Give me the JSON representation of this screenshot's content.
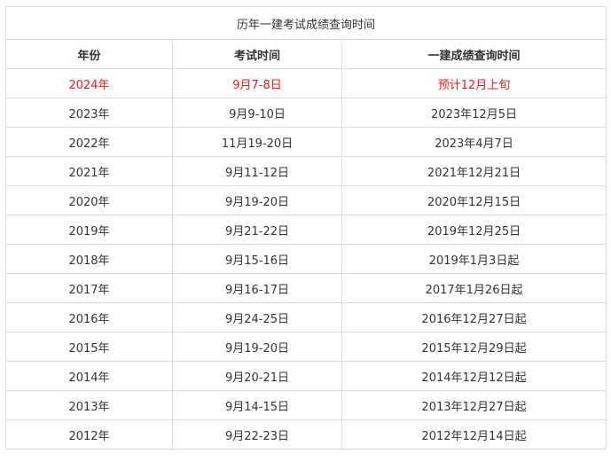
{
  "table": {
    "title": "历年一建考试成绩查询时间",
    "headers": [
      "年份",
      "考试时间",
      "一建成绩查询时间"
    ],
    "highlight_color": "#e02020",
    "rows": [
      {
        "year": "2024年",
        "exam": "9月7-8日",
        "result": "预计12月上旬",
        "highlight": true
      },
      {
        "year": "2023年",
        "exam": "9月9-10日",
        "result": "2023年12月5日"
      },
      {
        "year": "2022年",
        "exam": "11月19-20日",
        "result": "2023年4月7日"
      },
      {
        "year": "2021年",
        "exam": "9月11-12日",
        "result": "2021年12月21日"
      },
      {
        "year": "2020年",
        "exam": "9月19-20日",
        "result": "2020年12月15日"
      },
      {
        "year": "2019年",
        "exam": "9月21-22日",
        "result": "2019年12月25日"
      },
      {
        "year": "2018年",
        "exam": "9月15-16日",
        "result": "2019年1月3日起"
      },
      {
        "year": "2017年",
        "exam": "9月16-17日",
        "result": "2017年1月26日起"
      },
      {
        "year": "2016年",
        "exam": "9月24-25日",
        "result": "2016年12月27日起"
      },
      {
        "year": "2015年",
        "exam": "9月19-20日",
        "result": "2015年12月29日起"
      },
      {
        "year": "2014年",
        "exam": "9月20-21日",
        "result": "2014年12月12日起"
      },
      {
        "year": "2013年",
        "exam": "9月14-15日",
        "result": "2013年12月27日起"
      },
      {
        "year": "2012年",
        "exam": "9月22-23日",
        "result": "2012年12月14日起"
      }
    ]
  }
}
